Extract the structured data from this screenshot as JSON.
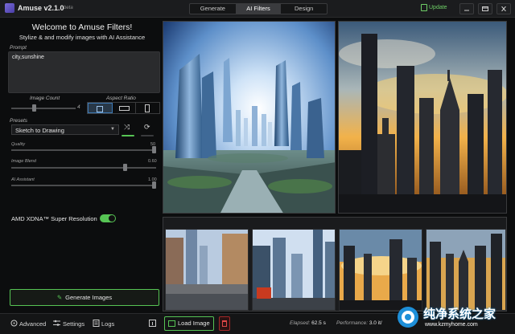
{
  "app": {
    "title": "Amuse v2.1.0",
    "version_tag": "beta"
  },
  "tabs": [
    {
      "label": "Generate",
      "active": false
    },
    {
      "label": "AI Filters",
      "active": true
    },
    {
      "label": "Design",
      "active": false
    }
  ],
  "header": {
    "update_label": "Update"
  },
  "left": {
    "welcome": "Welcome to Amuse Filters!",
    "subtitle": "Stylize & and modify images with AI Assistance",
    "prompt_label": "Prompt",
    "prompt_value": "city,sunshine",
    "image_count_label": "Image Count",
    "image_count_value": "4",
    "aspect_ratio_label": "Aspect Ratio",
    "presets_label": "Presets",
    "preset_value": "Sketch to Drawing",
    "quality_label": "Quality",
    "quality_value": "50",
    "image_blend_label": "Image Blend",
    "image_blend_value": "0.60",
    "ai_assistant_label": "AI Assistant",
    "ai_assistant_value": "1.00",
    "xdna_label": "AMD XDNA™ Super Resolution",
    "generate_label": "Generate Images"
  },
  "bottom": {
    "advanced_label": "Advanced",
    "settings_label": "Settings",
    "logs_label": "Logs",
    "load_image_label": "Load Image",
    "elapsed_label": "Elapsed:",
    "elapsed_value": "62.5 s",
    "performance_label": "Performance:",
    "performance_value": "3.0 it/"
  },
  "watermark": {
    "title": "纯净系统之家",
    "url": "www.kzmyhome.com"
  },
  "colors": {
    "accent_green": "#56c454",
    "active_blue": "#3d7ab6",
    "bg": "#0c0d0e"
  }
}
